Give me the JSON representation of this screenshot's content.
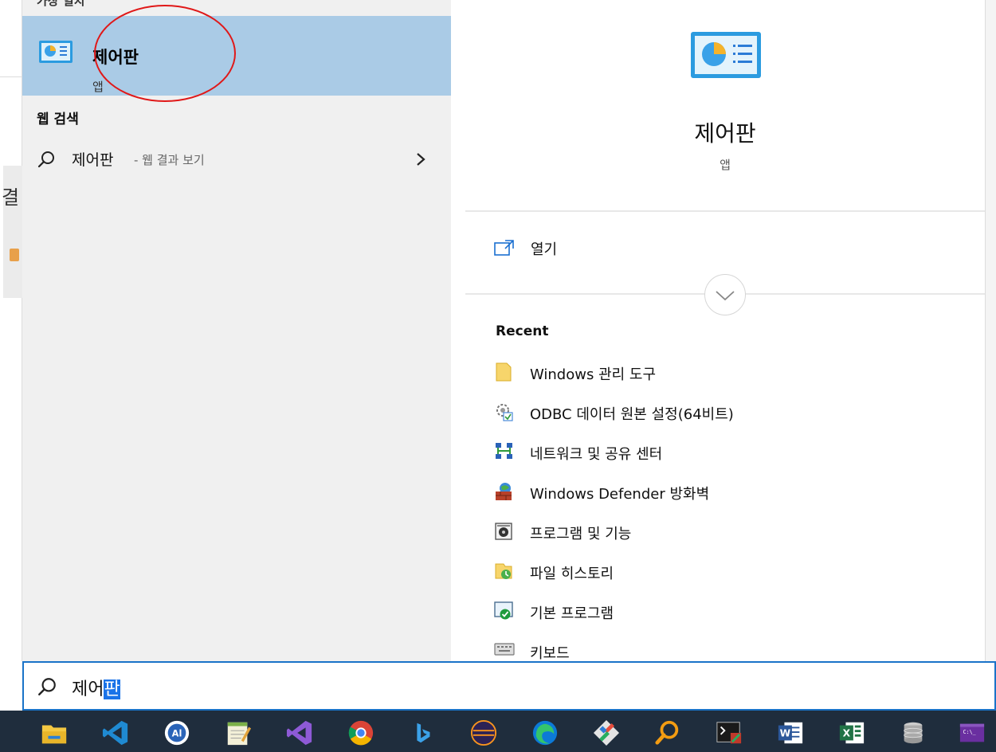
{
  "search": {
    "section_header_partial": "가장 일치",
    "best_match": {
      "title": "제어판",
      "subtitle": "앱"
    },
    "web_header": "웹 검색",
    "web_result": {
      "query": "제어판",
      "suffix": " - 웹 결과 보기"
    }
  },
  "preview": {
    "title": "제어판",
    "subtitle": "앱",
    "open_label": "열기",
    "recent_title": "Recent",
    "recent": [
      {
        "label": "Windows 관리 도구",
        "icon": "folder-icon"
      },
      {
        "label": "ODBC 데이터 원본 설정(64비트)",
        "icon": "odbc-icon"
      },
      {
        "label": "네트워크 및 공유 센터",
        "icon": "network-icon"
      },
      {
        "label": "Windows Defender 방화벽",
        "icon": "firewall-icon"
      },
      {
        "label": "프로그램 및 기능",
        "icon": "programs-icon"
      },
      {
        "label": "파일 히스토리",
        "icon": "file-history-icon"
      },
      {
        "label": "기본 프로그램",
        "icon": "default-programs-icon"
      },
      {
        "label": "키보드",
        "icon": "keyboard-icon"
      }
    ]
  },
  "searchbar": {
    "text_plain": "제어",
    "text_selected": "판"
  },
  "background": {
    "glyph": "결"
  },
  "taskbar": {
    "icons": [
      "file-explorer-icon",
      "vscode-icon",
      "app-icon",
      "notepad-icon",
      "visual-studio-icon",
      "chrome-icon",
      "bing-icon",
      "eclipse-icon",
      "edge-icon",
      "git-icon",
      "search-tool-icon",
      "terminal-icon",
      "word-icon",
      "excel-icon",
      "database-icon",
      "console-icon"
    ]
  },
  "colors": {
    "accent": "#1a73c8",
    "highlight": "#aacbe6",
    "taskbar": "#1f2d3d",
    "circle": "#e01818"
  }
}
